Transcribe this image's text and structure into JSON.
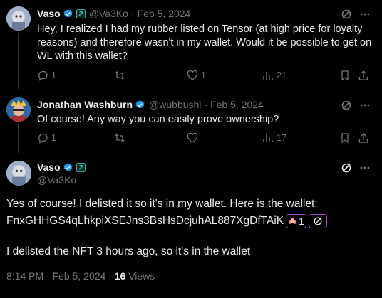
{
  "tweets": [
    {
      "name": "Vaso",
      "handle": "@Va3Ko",
      "sep": "·",
      "date": "Feb 5, 2024",
      "text_lines": [
        "Hey, I realized I had my rubber listed on Tensor (at high price for loyalty",
        "reasons) and therefore wasn't in my wallet. Would it be possible to get on",
        "WL with this wallet?"
      ],
      "replies": "1",
      "reposts": "",
      "likes": "1",
      "views": "21"
    },
    {
      "name": "Jonathan Washburn",
      "handle": "@wubbushi",
      "sep": "·",
      "date": "Feb 5, 2024",
      "text_lines": [
        "Of course! Any way you can easily prove ownership?"
      ],
      "replies": "1",
      "reposts": "",
      "likes": "",
      "views": "17"
    }
  ],
  "main_tweet": {
    "name": "Vaso",
    "handle": "@Va3Ko",
    "line1": "Yes of course! I delisted it so it's in my wallet. Here is the wallet:",
    "wallet": "FnxGHHGS4qLhkpiXSEJns3BsHsDcjuhAL887XgDfTAiK",
    "chip_count": "1",
    "line3": "I delisted the NFT 3 hours ago, so it's in the wallet",
    "time": "8:14 PM · Feb 5, 2024 · ",
    "views_count": "16",
    "views_label": " Views"
  },
  "colors": {
    "background": "#000000",
    "text": "#e7e9ea",
    "muted": "#71767b",
    "verified": "#1d9bf0",
    "chip_border": "#a34ec9"
  },
  "icons": [
    "verified-icon",
    "affiliate-icon",
    "grok-icon",
    "more-icon",
    "reply-icon",
    "repost-icon",
    "like-icon",
    "views-icon",
    "bookmark-icon",
    "share-icon"
  ]
}
